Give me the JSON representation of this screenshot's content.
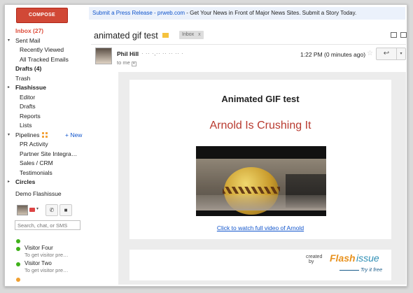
{
  "left": {
    "compose_label": "COMPOSE",
    "nav": [
      {
        "label": "Inbox (27)",
        "style": "red"
      },
      {
        "label": "Sent Mail",
        "arrow": "▾"
      },
      {
        "label": "Recently Viewed",
        "indent": true
      },
      {
        "label": "All Tracked Emails",
        "indent": true
      },
      {
        "label": "Drafts (4)",
        "style": "bold"
      },
      {
        "label": "Trash"
      },
      {
        "label": "Flashissue",
        "arrow": "▸",
        "style": "bold"
      },
      {
        "label": "Editor",
        "indent": true
      },
      {
        "label": "Drafts",
        "indent": true
      },
      {
        "label": "Reports",
        "indent": true
      },
      {
        "label": "Lists",
        "indent": true
      },
      {
        "label": "Pipelines",
        "arrow": "▾",
        "new": "+ New"
      },
      {
        "label": "PR Activity",
        "indent": true
      },
      {
        "label": "Partner Site Integra…",
        "indent": true
      },
      {
        "label": "Sales / CRM",
        "indent": true
      },
      {
        "label": "Testimonials",
        "indent": true
      },
      {
        "label": "Circles",
        "arrow": "▸",
        "style": "bold"
      },
      {
        "label": "Demo Flashissue"
      }
    ],
    "chat": {
      "search_placeholder": "Search, chat, or SMS",
      "contacts": [
        {
          "name": "Visitor Four",
          "sub": "To get visitor pre…"
        },
        {
          "name": "Visitor Two",
          "sub": "To get visitor pre…"
        }
      ]
    }
  },
  "ad": {
    "link": "Submit a Press Release - prweb.com",
    "text": " - Get Your News in Front of Major News Sites. Submit a Story Today."
  },
  "thread": {
    "subject": "animated gif test",
    "label": "Inbox",
    "label_close": "x"
  },
  "message": {
    "sender": "Phil Hill",
    "sender_email": "· ·· ·,·· ·· ·· ·· ·",
    "to": "to me",
    "time": "1:22 PM (0 minutes ago)",
    "star": "☆",
    "reply": "↩",
    "more": "▾"
  },
  "email": {
    "title": "Animated GIF test",
    "subtitle": "Arnold Is Crushing It",
    "link": "Click to watch full video of Arnold",
    "brand": {
      "created": "created",
      "by": "by",
      "flash": "Flash",
      "issue": "issue",
      "try": "Try it free"
    }
  }
}
